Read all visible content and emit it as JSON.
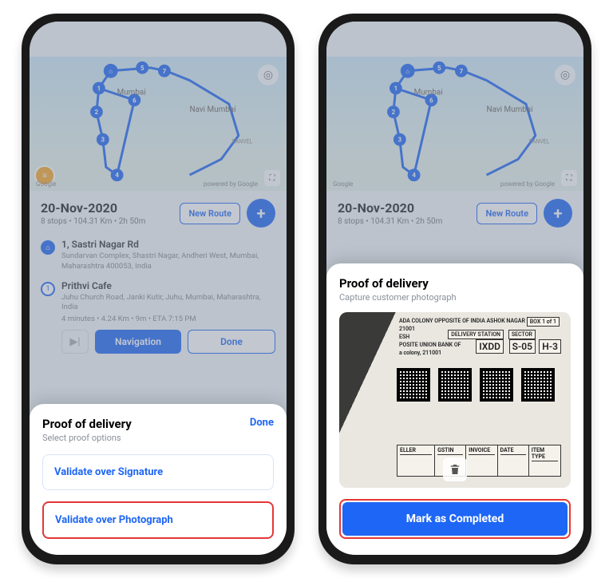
{
  "map": {
    "city1": "Mumbai",
    "city2": "Navi Mumbai",
    "panvel": "PANVEL",
    "attrib_left": "Google",
    "attrib_right": "powered by Google",
    "pins": [
      "1",
      "2",
      "3",
      "4",
      "5",
      "6",
      "7"
    ]
  },
  "route_header": {
    "date": "20-Nov-2020",
    "summary": "8 stops • 104.31 Km • 2h 50m",
    "new_route": "New Route"
  },
  "stops": {
    "home": {
      "title": "1, Sastri Nagar Rd",
      "addr": "Sundarvan Complex, Shastri Nagar, Andheri West, Mumbai, Maharashtra 400053, India"
    },
    "s1": {
      "num": "1",
      "title": "Prithvi Cafe",
      "addr": "Juhu Church Road, Janki Kutir, Juhu, Mumbai, Maharashtra, India",
      "meta": "4 minutes • 4.24 Km • 9m • ETA 7:15 PM"
    }
  },
  "actions": {
    "navigation": "Navigation",
    "done": "Done"
  },
  "sheet1": {
    "title": "Proof of delivery",
    "sub": "Select proof options",
    "done": "Done",
    "opt_sign": "Validate over Signature",
    "opt_photo": "Validate over Photograph"
  },
  "sheet2": {
    "title": "Proof of delivery",
    "sub": "Capture customer photograph",
    "mark": "Mark as Completed",
    "doc": {
      "top1": "ADA COLONY OPPOSITE OF INDIA ASHOK NAGAR",
      "top2": "21001",
      "top3": "ESH",
      "top4": "POSITE UNION BANK OF",
      "top5": "a colony, 211001",
      "box": "BOX 1 of 1",
      "station": "DELIVERY STATION",
      "station_v": "IXDD",
      "sector": "SECTOR",
      "sector_v": "S-05",
      "h": "H-3",
      "c1": "ELLER",
      "c2": "GSTIN",
      "c3": "INVOICE",
      "c4": "DATE",
      "c5": "ITEM TYPE"
    }
  }
}
